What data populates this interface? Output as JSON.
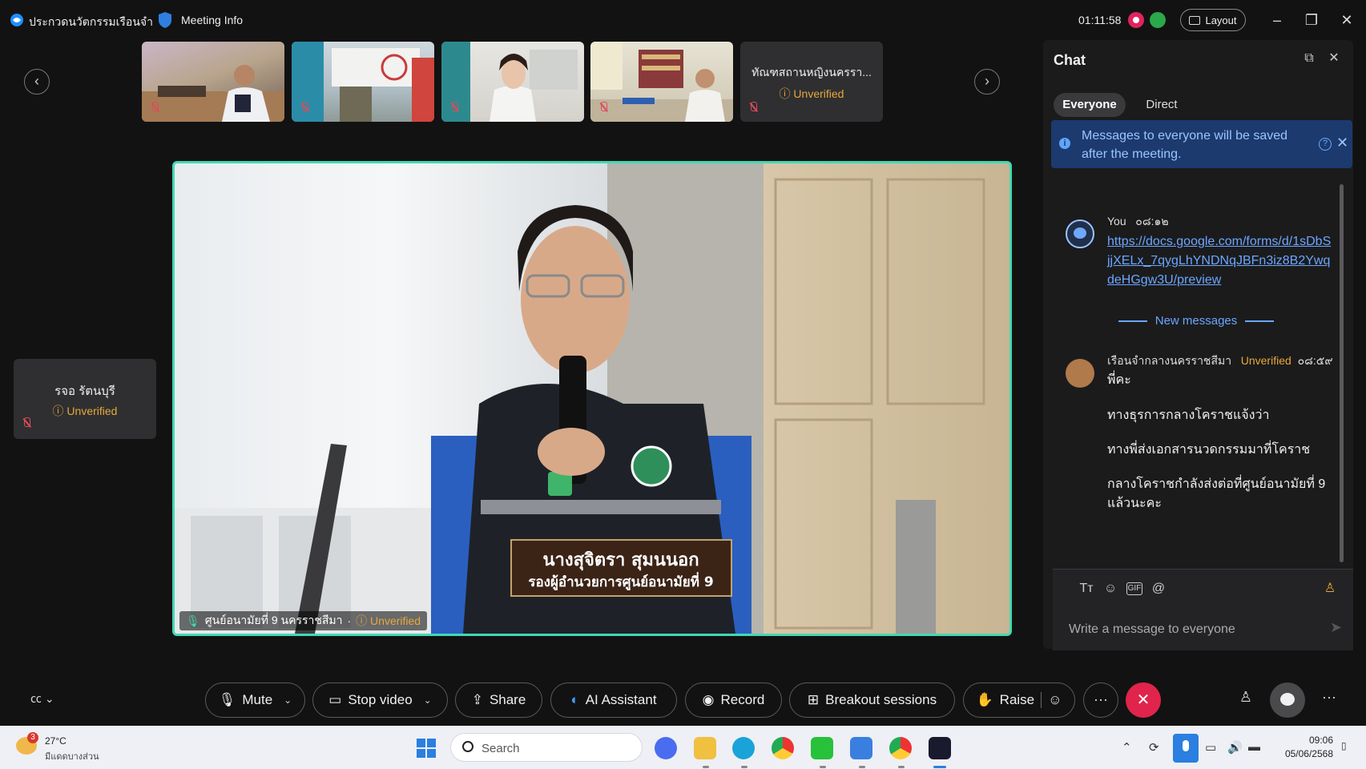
{
  "titlebar": {
    "app_title": "ประกวดนวัตกรรมเรือนจำ",
    "meeting_info": "Meeting Info",
    "timer": "01:11:58",
    "layout_label": "Layout"
  },
  "thumbnails": [
    {
      "kind": "video",
      "muted": true
    },
    {
      "kind": "video",
      "muted": true
    },
    {
      "kind": "video",
      "muted": true
    },
    {
      "kind": "video",
      "muted": true
    },
    {
      "kind": "text",
      "name": "ทัณฑสถานหญิงนครรา...",
      "status": "Unverified",
      "muted": true
    }
  ],
  "side_tile": {
    "name": "รจอ รัตนบุรี",
    "status": "Unverified"
  },
  "main_video": {
    "speaker_label": "ศูนย์อนามัยที่ 9 นครราชสีมา",
    "status": "Unverified",
    "caption_line1": "นางสุจิตรา สุมนนอก",
    "caption_line2": "รองผู้อำนวยการศูนย์อนามัยที่ 9"
  },
  "chat": {
    "title": "Chat",
    "tabs": [
      "Everyone",
      "Direct"
    ],
    "notice": "Messages to everyone will be saved after the meeting.",
    "messages": [
      {
        "sender": "You",
        "time": "๐๘:๑๒",
        "text": "https://docs.google.com/forms/d/1sDbSjjXELx_7qygLhYNDNqJBFn3iz8B2YwqdeHGgw3U/preview"
      },
      {
        "sender": "เรือนจำกลางนครราชสีมา",
        "status": "Unverified",
        "time": "๐๘:๕๙",
        "lines": [
          "พี่คะ",
          "ทางธุรการกลางโคราชแจ้งว่า",
          "ทางพี่ส่งเอกสารนวดกรรมมาที่โคราช",
          "กลางโคราชกำลังส่งต่อที่ศูนย์อนามัยที่ 9 แล้วนะคะ"
        ]
      }
    ],
    "new_messages_label": "New messages",
    "composer_placeholder": "Write a message to everyone"
  },
  "toolbar": {
    "mute": "Mute",
    "stop_video": "Stop video",
    "share": "Share",
    "ai_assistant": "AI Assistant",
    "record": "Record",
    "breakout": "Breakout sessions",
    "raise": "Raise"
  },
  "taskbar": {
    "weather_badge": "3",
    "temperature": "27°C",
    "weather_desc": "มีแดดบางส่วน",
    "search_label": "Search",
    "time": "09:06",
    "date": "05/06/2568"
  },
  "colors": {
    "accent_teal": "#41d9b3",
    "unverified": "#e7a83a",
    "link": "#6ba6ff",
    "end_call": "#e0244b",
    "notice_bg": "#1c3a6e"
  }
}
